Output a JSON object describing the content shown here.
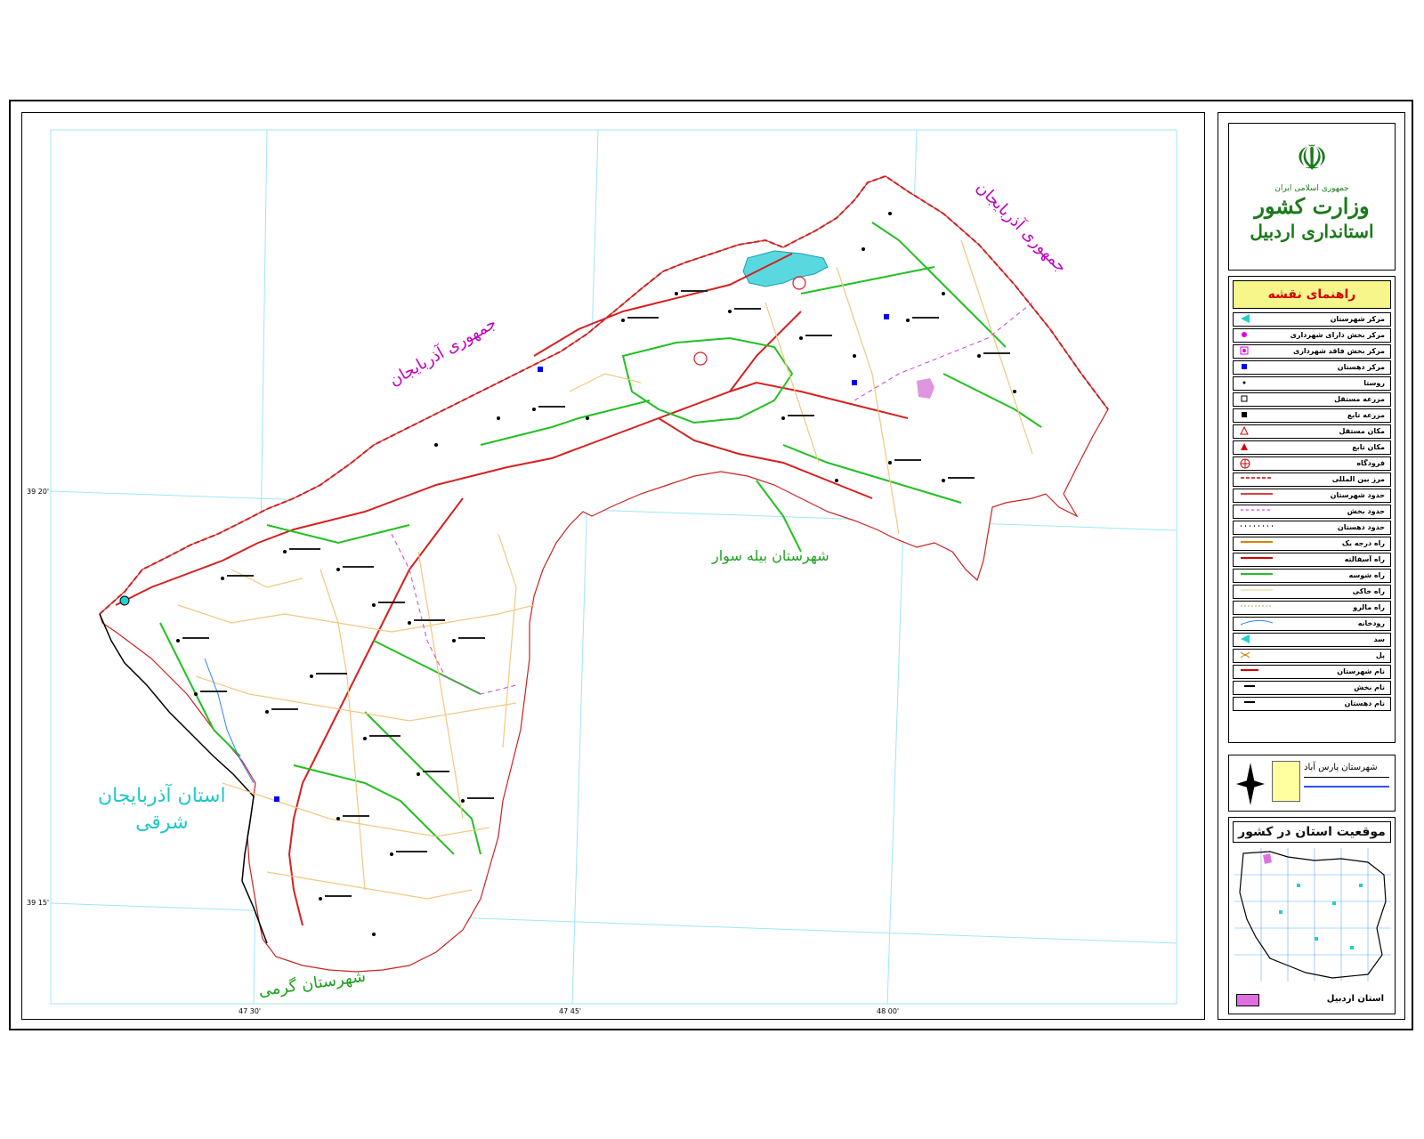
{
  "map": {
    "labels": {
      "country_nw": "جمهوری آذربایجان",
      "country_ne": "جمهوری آذربایجان",
      "province_w_line1": "استان آذربایجان",
      "province_w_line2": "شرقی",
      "county_s": "شهرستان گرمی",
      "county_e": "شهرستان بیله سوار"
    },
    "coordinates": {
      "lat_39_20": "39 20'",
      "lat_39_15": "39 15'",
      "lon_47_30": "47 30'",
      "lon_47_45": "47 45'",
      "lon_48_00": "48 00'"
    }
  },
  "ministry": {
    "republic": "جمهوری اسلامی ایران",
    "title": "وزارت کشور",
    "subtitle": "استانداری اردبیل"
  },
  "legend": {
    "title": "راهنمای نقشه",
    "items": [
      {
        "label": "مرکز شهرستان",
        "symbol": "county-center",
        "color": "#1fd0d0"
      },
      {
        "label": "مرکز بخش دارای شهرداری",
        "symbol": "district-city",
        "color": "#e000e0"
      },
      {
        "label": "مرکز بخش فاقد شهرداری",
        "symbol": "district-nocity",
        "color": "#e000e0"
      },
      {
        "label": "مرکز دهستان",
        "symbol": "rural-center",
        "color": "#0000ff"
      },
      {
        "label": "روستا",
        "symbol": "village",
        "color": "#000000"
      },
      {
        "label": "مزرعه مستقل",
        "symbol": "farm",
        "color": "#000000"
      },
      {
        "label": "مزرعه تابع",
        "symbol": "farm-dep",
        "color": "#000000"
      },
      {
        "label": "مکان مستقل",
        "symbol": "place",
        "color": "#d40000"
      },
      {
        "label": "مکان تابع",
        "symbol": "place-dep",
        "color": "#d40000"
      },
      {
        "label": "فرودگاه",
        "symbol": "airport",
        "color": "#d40000"
      },
      {
        "label": "مرز بین المللی",
        "symbol": "intl-border",
        "color": "#d40000"
      },
      {
        "label": "حدود شهرستان",
        "symbol": "county-border",
        "color": "#d40000"
      },
      {
        "label": "حدود بخش",
        "symbol": "district-border",
        "color": "#e000e0"
      },
      {
        "label": "حدود دهستان",
        "symbol": "rural-border",
        "color": "#000000"
      },
      {
        "label": "راه درجه یک",
        "symbol": "road-1",
        "color": "#e08000"
      },
      {
        "label": "راه آسفالته",
        "symbol": "road-asphalt",
        "color": "#d40000"
      },
      {
        "label": "راه شوسه",
        "symbol": "road-gravel",
        "color": "#20c020"
      },
      {
        "label": "راه خاکی",
        "symbol": "road-dirt",
        "color": "#f0c880"
      },
      {
        "label": "راه مالرو",
        "symbol": "road-mule",
        "color": "#c0a060"
      },
      {
        "label": "رودخانه",
        "symbol": "river",
        "color": "#3080ff"
      },
      {
        "label": "سد",
        "symbol": "dam",
        "color": "#1fd0d0"
      },
      {
        "label": "پل",
        "symbol": "bridge",
        "color": "#d08000"
      },
      {
        "label": "نام شهرستان",
        "symbol": "name-county",
        "color": "#d40000"
      },
      {
        "label": "نام بخش",
        "symbol": "name-district",
        "color": "#000000"
      },
      {
        "label": "نام دهستان",
        "symbol": "name-rural",
        "color": "#000000"
      }
    ]
  },
  "info": {
    "county": "شهرستان پارس آباد"
  },
  "location": {
    "title": "موقعیت استان در کشور",
    "province_label": "استان اردبیل"
  }
}
